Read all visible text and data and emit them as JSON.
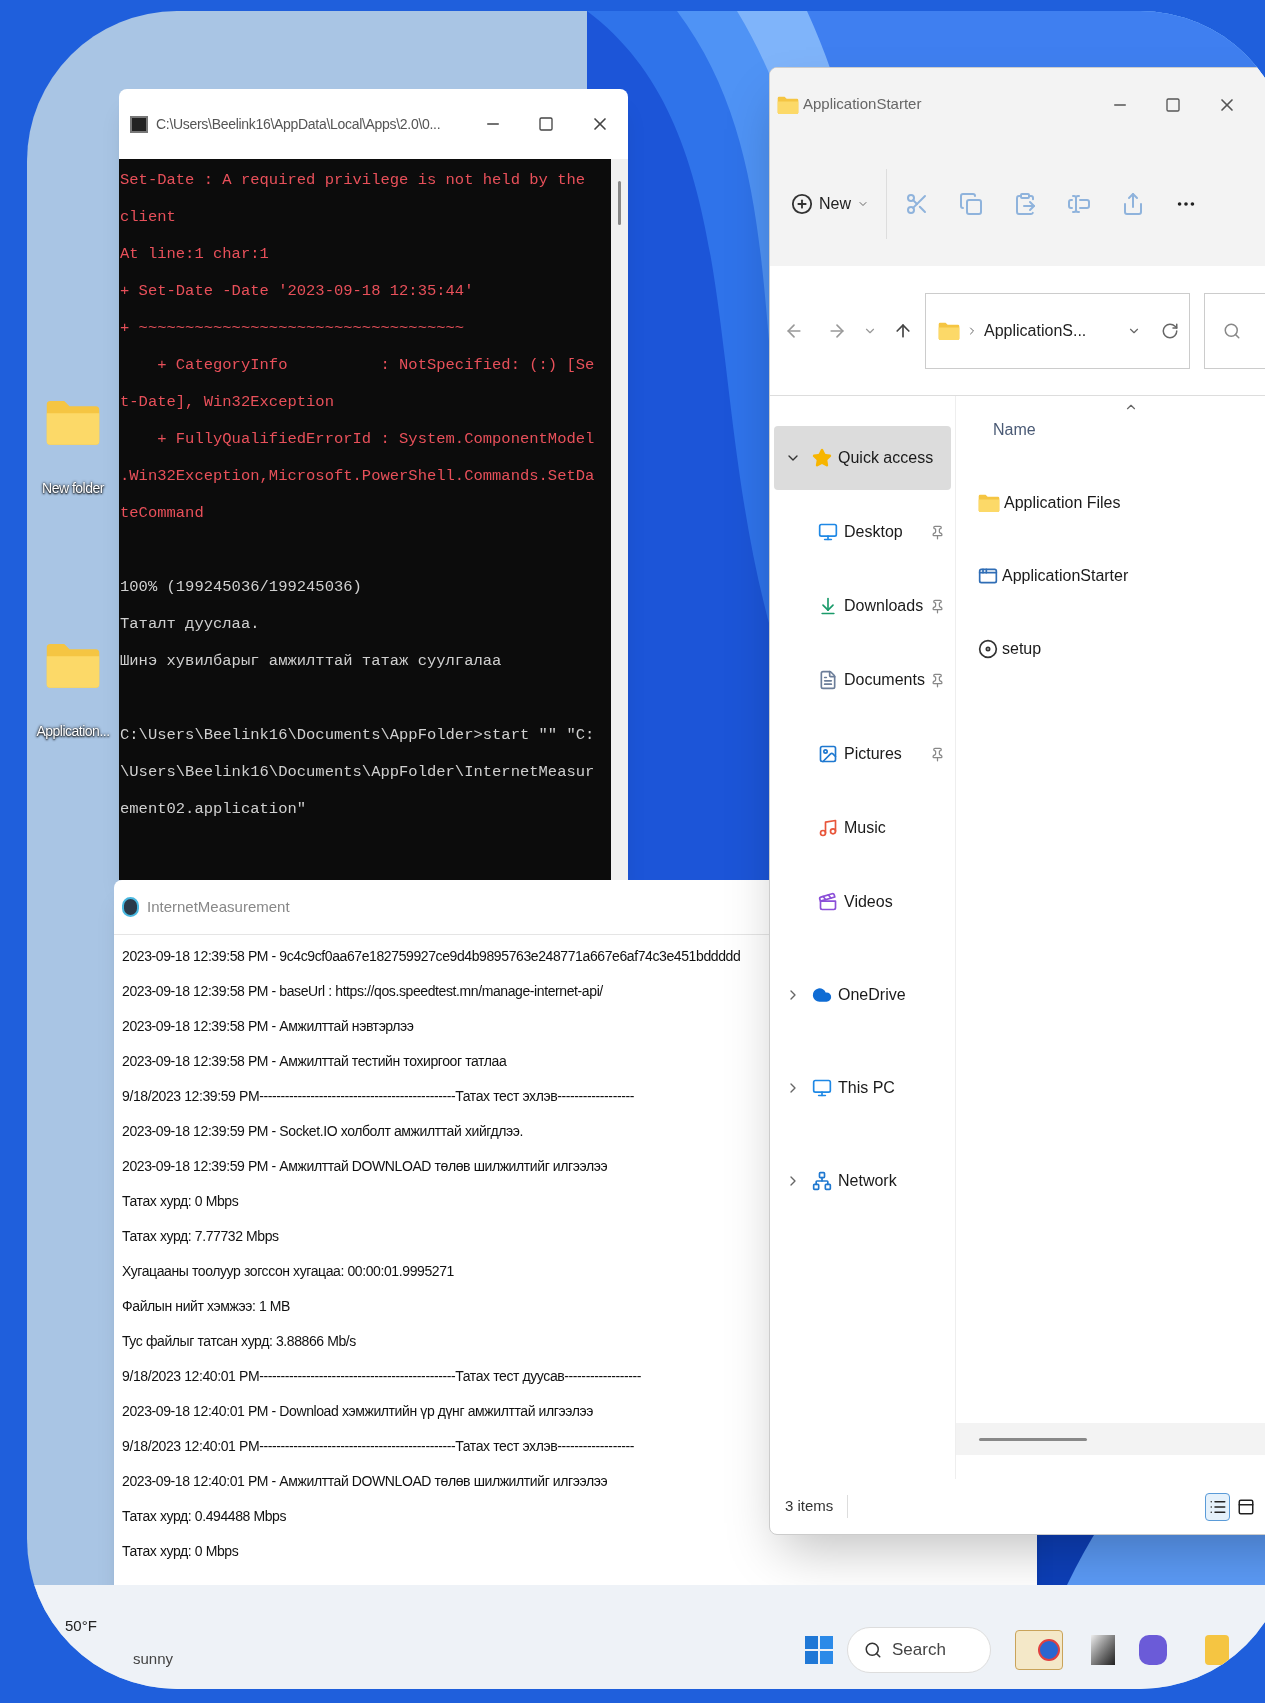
{
  "desktop_icons": [
    {
      "label": "New folder"
    },
    {
      "label": "Application..."
    }
  ],
  "terminal": {
    "title": "C:\\Users\\Beelink16\\AppData\\Local\\Apps\\2.0\\0...",
    "blocks": [
      {
        "kind": "error",
        "lines": [
          "Set-Date : A required privilege is not held by the",
          "client",
          "At line:1 char:1",
          "+ Set-Date -Date '2023-09-18 12:35:44'",
          "+ ~~~~~~~~~~~~~~~~~~~~~~~~~~~~~~~~~~~",
          "    + CategoryInfo          : NotSpecified: (:) [Se",
          "t-Date], Win32Exception",
          "    + FullyQualifiedErrorId : System.ComponentModel",
          ".Win32Exception,Microsoft.PowerShell.Commands.SetDa",
          "teCommand"
        ]
      },
      {
        "kind": "output",
        "lines": [
          "100% (199245036/199245036)",
          "Таталт дууслаа.",
          "Шинэ хувилбарыг амжилттай татаж суулгалаа"
        ]
      },
      {
        "kind": "output",
        "lines": [
          "C:\\Users\\Beelink16\\Documents\\AppFolder>start \"\" \"C:",
          "\\Users\\Beelink16\\Documents\\AppFolder\\InternetMeasur",
          "ement02.application\""
        ]
      }
    ]
  },
  "explorer": {
    "title": "ApplicationStarter",
    "new_label": "New",
    "address": "ApplicationS...",
    "nav": [
      {
        "label": "Quick access",
        "kind": "star",
        "expanded": true,
        "selected": true,
        "children": [
          {
            "label": "Desktop",
            "kind": "desktop",
            "pinned": true,
            "selected": false
          },
          {
            "label": "Downloads",
            "kind": "downloads",
            "pinned": true,
            "selected": false
          },
          {
            "label": "Documents",
            "kind": "documents",
            "pinned": true,
            "selected": false
          },
          {
            "label": "Pictures",
            "kind": "pictures",
            "pinned": true,
            "selected": false
          },
          {
            "label": "Music",
            "kind": "music",
            "pinned": false,
            "selected": false
          },
          {
            "label": "Videos",
            "kind": "videos",
            "pinned": false,
            "selected": false
          }
        ]
      },
      {
        "label": "OneDrive",
        "kind": "cloud",
        "expanded": false,
        "selected": false
      },
      {
        "label": "This PC",
        "kind": "pc",
        "expanded": false,
        "selected": false
      },
      {
        "label": "Network",
        "kind": "network",
        "expanded": false,
        "selected": false
      }
    ],
    "column": "Name",
    "files": [
      {
        "name": "Application Files",
        "kind": "folder"
      },
      {
        "name": "ApplicationStarter",
        "kind": "application"
      },
      {
        "name": "setup",
        "kind": "setup"
      }
    ],
    "status": "3 items",
    "views": [
      {
        "kind": "details",
        "selected": true
      },
      {
        "kind": "tiles",
        "selected": false
      }
    ]
  },
  "log_window": {
    "title": "InternetMeasurement",
    "lines": [
      "2023-09-18 12:39:58 PM - 9c4c9cf0aa67e182759927ce9d4b9895763e248771a667e6af74c3e451bddddd",
      "2023-09-18 12:39:58 PM - baseUrl : https://qos.speedtest.mn/manage-internet-api/",
      "2023-09-18 12:39:58 PM - Амжилттай нэвтэрлээ",
      "2023-09-18 12:39:58 PM - Амжилттай тестийн тохиргоог татлаа",
      "9/18/2023 12:39:59 PM----------------------------------------------Татах тест эхлэв------------------",
      "2023-09-18 12:39:59 PM - Socket.IO холболт амжилттай хийгдлээ.",
      "2023-09-18 12:39:59 PM - Амжилттай DOWNLOAD төлөв шилжилтийг илгээлээ",
      "Татах хурд: 0 Mbps",
      "Татах хурд: 7.77732 Mbps",
      "Хугацааны тоолуур зогссон хугацаа: 00:00:01.9995271",
      "Файлын нийт хэмжээ: 1 MB",
      "Тус файлыг татсан хурд: 3.88866 Mb/s",
      "9/18/2023 12:40:01 PM----------------------------------------------Татах тест дуусав------------------",
      "2023-09-18 12:40:01 PM - Download хэмжилтийн үр дүнг амжилттай илгээлээ",
      "9/18/2023 12:40:01 PM----------------------------------------------Татах тест эхлэв------------------",
      "2023-09-18 12:40:01 PM - Амжилттай DOWNLOAD төлөв шилжилтийг илгээлээ",
      "Татах хурд: 0.494488 Mbps",
      "Татах хурд: 0 Mbps"
    ]
  },
  "taskbar": {
    "temperature": "50°F",
    "condition": "sunny",
    "search_label": "Search"
  }
}
